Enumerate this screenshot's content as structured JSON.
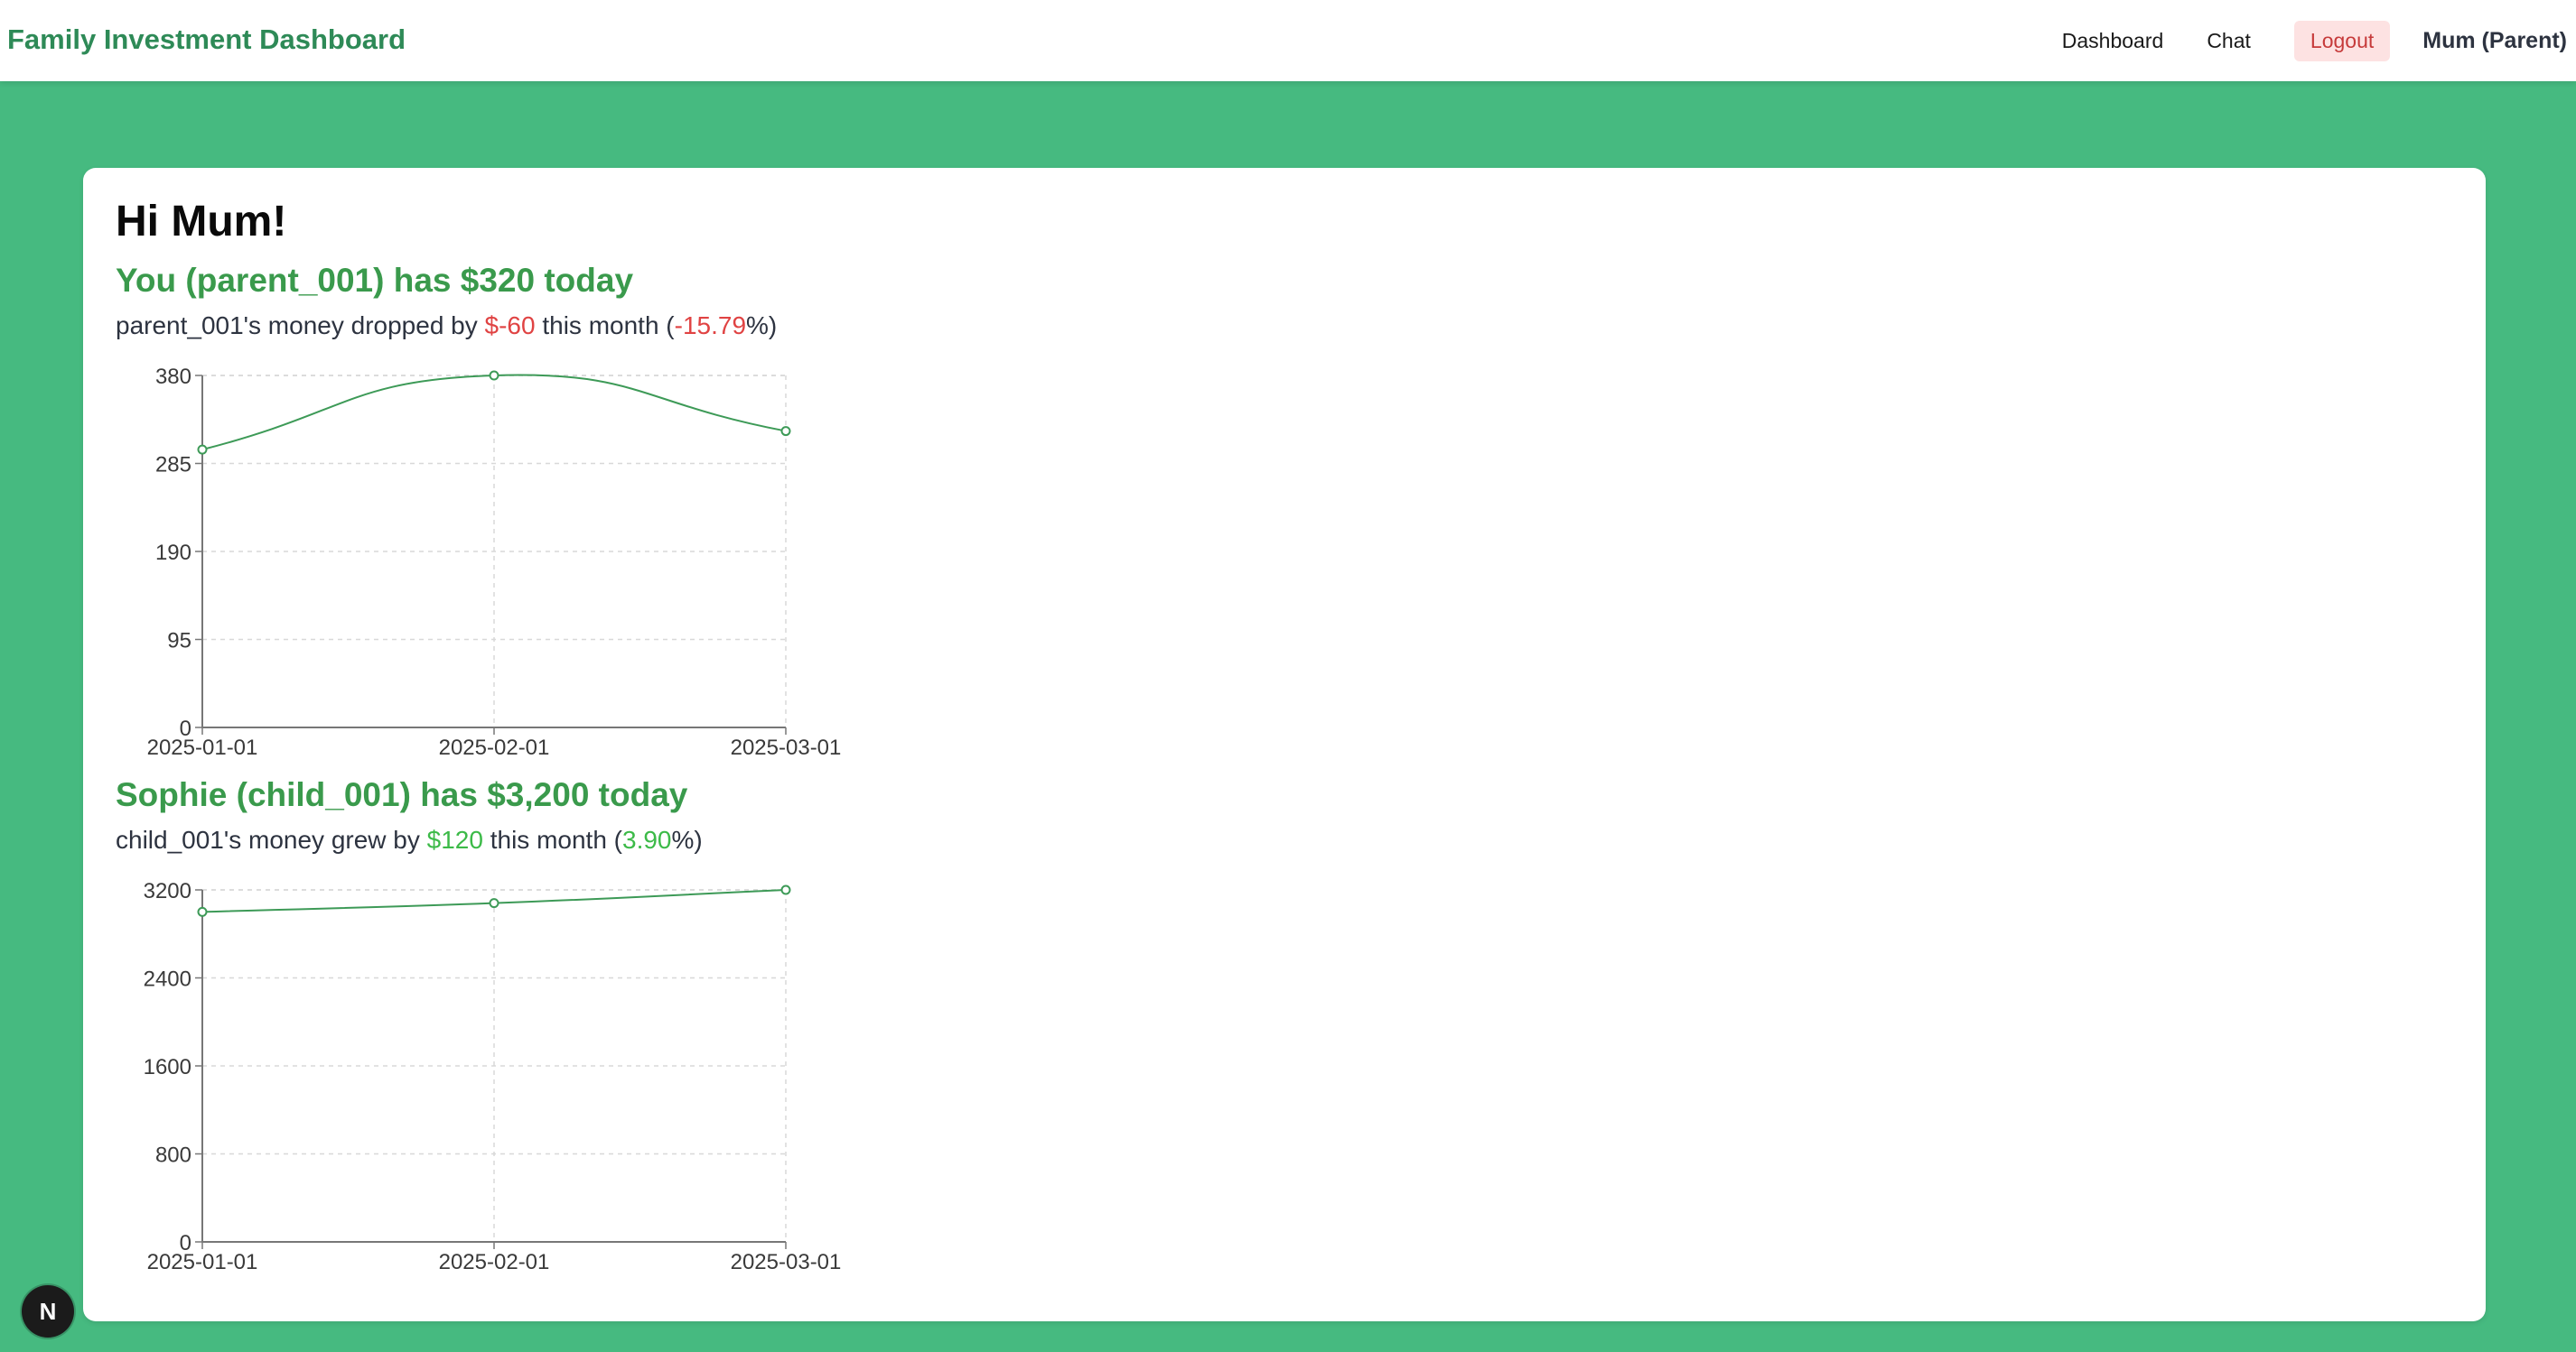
{
  "header": {
    "app_title": "Family Investment Dashboard",
    "nav": {
      "dashboard": "Dashboard",
      "chat": "Chat",
      "logout": "Logout"
    },
    "user": "Mum (Parent)"
  },
  "greeting": "Hi Mum!",
  "members": [
    {
      "title": "You (parent_001) has $320 today",
      "change": {
        "prefix": "parent_001's money dropped by ",
        "amount": "$-60",
        "middle": " this month (",
        "percent": "-15.79",
        "suffix": "%)"
      }
    },
    {
      "title": "Sophie (child_001) has $3,200 today",
      "change": {
        "prefix": "child_001's money grew by ",
        "amount": "$120",
        "middle": " this month (",
        "percent": "3.90",
        "suffix": "%)"
      }
    }
  ],
  "colors": {
    "background": "#46ba80",
    "line": "#3d9a57",
    "negative": "#e04343",
    "positive": "#3cba48"
  },
  "badge": "N",
  "chart_data": [
    {
      "type": "line",
      "x": [
        "2025-01-01",
        "2025-02-01",
        "2025-03-01"
      ],
      "values": [
        300,
        380,
        320
      ],
      "yticks": [
        0,
        95,
        190,
        285,
        380
      ],
      "ylim": [
        0,
        380
      ],
      "grid": true
    },
    {
      "type": "line",
      "x": [
        "2025-01-01",
        "2025-02-01",
        "2025-03-01"
      ],
      "values": [
        3000,
        3080,
        3200
      ],
      "yticks": [
        0,
        800,
        1600,
        2400,
        3200
      ],
      "ylim": [
        0,
        3200
      ],
      "grid": true
    }
  ]
}
